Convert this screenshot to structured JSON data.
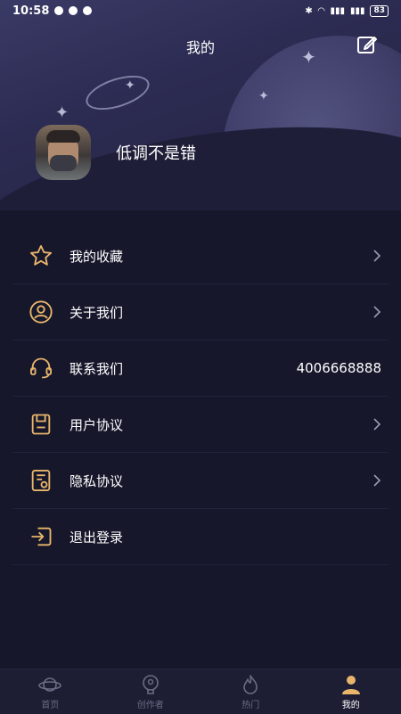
{
  "status": {
    "time": "10:58",
    "battery": "83"
  },
  "header": {
    "title": "我的"
  },
  "profile": {
    "username": "低调不是错"
  },
  "menu": [
    {
      "label": "我的收藏",
      "icon": "star-icon",
      "chevron": true
    },
    {
      "label": "关于我们",
      "icon": "user-circle-icon",
      "chevron": true
    },
    {
      "label": "联系我们",
      "icon": "headset-icon",
      "value": "4006668888",
      "chevron": false
    },
    {
      "label": "用户协议",
      "icon": "document-icon",
      "chevron": true
    },
    {
      "label": "隐私协议",
      "icon": "privacy-doc-icon",
      "chevron": true
    },
    {
      "label": "退出登录",
      "icon": "logout-icon",
      "chevron": false
    }
  ],
  "tabs": [
    {
      "label": "首页",
      "icon": "planet-icon",
      "active": false
    },
    {
      "label": "创作者",
      "icon": "bulb-icon",
      "active": false
    },
    {
      "label": "热门",
      "icon": "fire-icon",
      "active": false
    },
    {
      "label": "我的",
      "icon": "person-icon",
      "active": true
    }
  ],
  "colors": {
    "accent": "#e8b56b",
    "background": "#16172b"
  }
}
